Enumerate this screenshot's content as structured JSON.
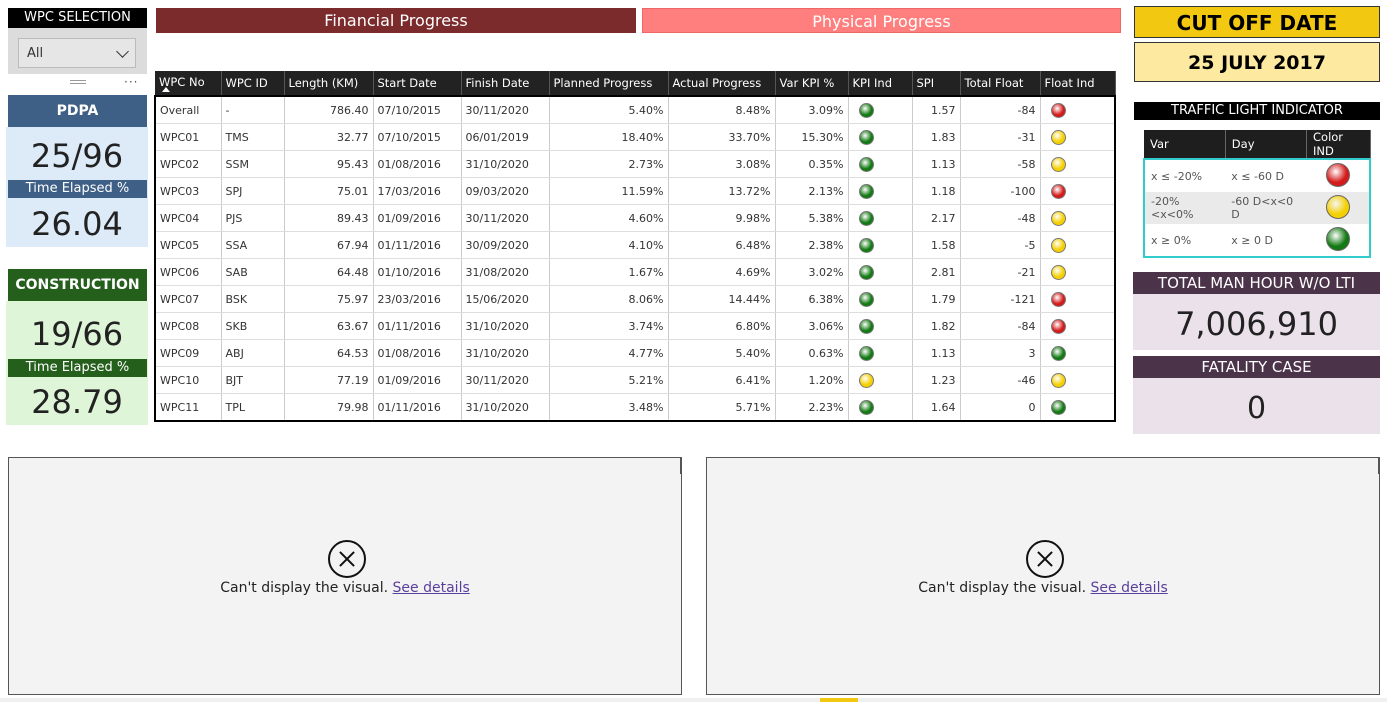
{
  "slicer": {
    "title": "WPC SELECTION",
    "selected": "All",
    "more": "···"
  },
  "pdpa": {
    "title": "PDPA",
    "count": "25/96",
    "elapsed_label": "Time Elapsed %",
    "elapsed_value": "26.04",
    "color": "#3e5f86"
  },
  "construction": {
    "title": "CONSTRUCTION",
    "count": "19/66",
    "elapsed_label": "Time Elapsed %",
    "elapsed_value": "28.79",
    "color": "#245f1c"
  },
  "headers": {
    "financial": "Financial Progress",
    "physical": "Physical Progress"
  },
  "table": {
    "columns": [
      "WPC No",
      "WPC ID",
      "Length (KM)",
      "Start Date",
      "Finish Date",
      "Planned Progress",
      "Actual Progress",
      "Var KPI %",
      "KPI Ind",
      "SPI",
      "Total Float",
      "Float Ind"
    ],
    "rows": [
      {
        "no": "Overall",
        "id": "-",
        "length": "786.40",
        "start": "07/10/2015",
        "finish": "30/11/2020",
        "planned": "5.40%",
        "actual": "8.48%",
        "var": "3.09%",
        "kpi": "green",
        "spi": "1.57",
        "float": "-84",
        "float_ind": "red"
      },
      {
        "no": "WPC01",
        "id": "TMS",
        "length": "32.77",
        "start": "07/10/2015",
        "finish": "06/01/2019",
        "planned": "18.40%",
        "actual": "33.70%",
        "var": "15.30%",
        "kpi": "green",
        "spi": "1.83",
        "float": "-31",
        "float_ind": "yellow"
      },
      {
        "no": "WPC02",
        "id": "SSM",
        "length": "95.43",
        "start": "01/08/2016",
        "finish": "31/10/2020",
        "planned": "2.73%",
        "actual": "3.08%",
        "var": "0.35%",
        "kpi": "green",
        "spi": "1.13",
        "float": "-58",
        "float_ind": "yellow"
      },
      {
        "no": "WPC03",
        "id": "SPJ",
        "length": "75.01",
        "start": "17/03/2016",
        "finish": "09/03/2020",
        "planned": "11.59%",
        "actual": "13.72%",
        "var": "2.13%",
        "kpi": "green",
        "spi": "1.18",
        "float": "-100",
        "float_ind": "red"
      },
      {
        "no": "WPC04",
        "id": "PJS",
        "length": "89.43",
        "start": "01/09/2016",
        "finish": "30/11/2020",
        "planned": "4.60%",
        "actual": "9.98%",
        "var": "5.38%",
        "kpi": "green",
        "spi": "2.17",
        "float": "-48",
        "float_ind": "yellow"
      },
      {
        "no": "WPC05",
        "id": "SSA",
        "length": "67.94",
        "start": "01/11/2016",
        "finish": "30/09/2020",
        "planned": "4.10%",
        "actual": "6.48%",
        "var": "2.38%",
        "kpi": "green",
        "spi": "1.58",
        "float": "-5",
        "float_ind": "yellow"
      },
      {
        "no": "WPC06",
        "id": "SAB",
        "length": "64.48",
        "start": "01/10/2016",
        "finish": "31/08/2020",
        "planned": "1.67%",
        "actual": "4.69%",
        "var": "3.02%",
        "kpi": "green",
        "spi": "2.81",
        "float": "-21",
        "float_ind": "yellow"
      },
      {
        "no": "WPC07",
        "id": "BSK",
        "length": "75.97",
        "start": "23/03/2016",
        "finish": "15/06/2020",
        "planned": "8.06%",
        "actual": "14.44%",
        "var": "6.38%",
        "kpi": "green",
        "spi": "1.79",
        "float": "-121",
        "float_ind": "red"
      },
      {
        "no": "WPC08",
        "id": "SKB",
        "length": "63.67",
        "start": "01/11/2016",
        "finish": "31/10/2020",
        "planned": "3.74%",
        "actual": "6.80%",
        "var": "3.06%",
        "kpi": "green",
        "spi": "1.82",
        "float": "-84",
        "float_ind": "red"
      },
      {
        "no": "WPC09",
        "id": "ABJ",
        "length": "64.53",
        "start": "01/08/2016",
        "finish": "31/10/2020",
        "planned": "4.77%",
        "actual": "5.40%",
        "var": "0.63%",
        "kpi": "green",
        "spi": "1.13",
        "float": "3",
        "float_ind": "green"
      },
      {
        "no": "WPC10",
        "id": "BJT",
        "length": "77.19",
        "start": "01/09/2016",
        "finish": "30/11/2020",
        "planned": "5.21%",
        "actual": "6.41%",
        "var": "1.20%",
        "kpi": "yellow",
        "spi": "1.23",
        "float": "-46",
        "float_ind": "yellow"
      },
      {
        "no": "WPC11",
        "id": "TPL",
        "length": "79.98",
        "start": "01/11/2016",
        "finish": "31/10/2020",
        "planned": "3.48%",
        "actual": "5.71%",
        "var": "2.23%",
        "kpi": "green",
        "spi": "1.64",
        "float": "0",
        "float_ind": "green"
      }
    ]
  },
  "light_colors": {
    "green": "#127a12",
    "yellow": "#f5d000",
    "red": "#d41a1a"
  },
  "cutoff": {
    "label": "CUT OFF DATE",
    "date": "25 JULY 2017"
  },
  "traffic": {
    "title": "TRAFFIC LIGHT INDICATOR",
    "columns": [
      "Var",
      "Day",
      "Color IND"
    ],
    "rows": [
      {
        "var": "x ≤ -20%",
        "day": "x ≤ -60 D",
        "color": "red"
      },
      {
        "var": "-20%<x<0%",
        "day": "-60 D<x<0 D",
        "color": "yellow"
      },
      {
        "var": "x ≥ 0%",
        "day": "x ≥ 0 D",
        "color": "green"
      }
    ]
  },
  "manhour": {
    "label": "TOTAL MAN HOUR W/O LTI",
    "value": "7,006,910"
  },
  "fatality": {
    "label": "FATALITY CASE",
    "value": "0"
  },
  "error_visual": {
    "message": "Can't display the visual.",
    "link": "See details"
  }
}
